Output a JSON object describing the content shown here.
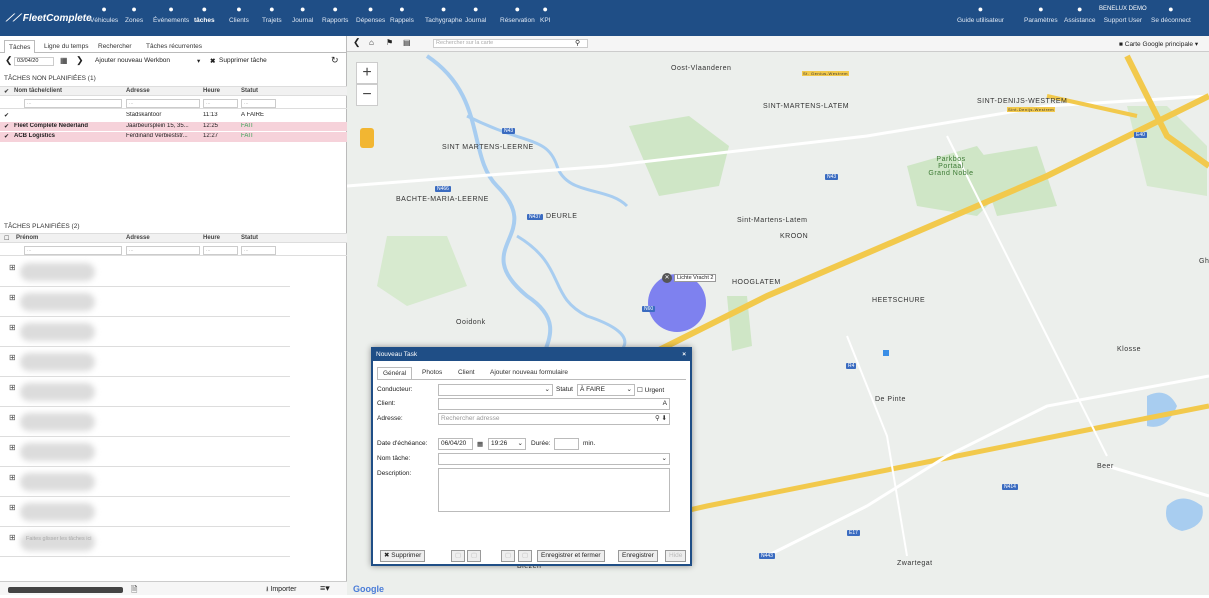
{
  "brand": "FleetComplete",
  "nav": [
    {
      "label": "Véhicules",
      "icon": "car-icon"
    },
    {
      "label": "Zones",
      "icon": "pin-icon"
    },
    {
      "label": "Événements",
      "icon": "warning-icon"
    },
    {
      "label": "tâches",
      "icon": "wrench-icon",
      "active": true
    },
    {
      "label": "Clients",
      "icon": "user-icon"
    },
    {
      "label": "Trajets",
      "icon": "route-icon"
    },
    {
      "label": "Journal",
      "icon": "calendar-icon"
    },
    {
      "label": "Rapports",
      "icon": "report-icon"
    },
    {
      "label": "Dépenses",
      "icon": "euro-icon"
    },
    {
      "label": "Rappels",
      "icon": "reminder-icon"
    },
    {
      "label": "Tachygraphe",
      "icon": "tachograph-icon"
    },
    {
      "label": "Journal",
      "icon": "journal-icon"
    },
    {
      "label": "Réservation",
      "icon": "reservation-icon"
    },
    {
      "label": "KPI",
      "icon": "kpi-icon"
    }
  ],
  "right_nav": [
    {
      "label": "Guide utilisateur",
      "icon": "book-icon"
    },
    {
      "label": "Paramètres",
      "icon": "gears-icon"
    },
    {
      "label": "Assistance",
      "icon": "chat-icon"
    },
    {
      "label": "Support User",
      "top": "BENELUX DEMO"
    },
    {
      "label": "Se déconnect",
      "icon": "logout-icon"
    }
  ],
  "left_tabs": [
    "Tâches",
    "Ligne du temps",
    "Rechercher",
    "Tâches récurrentes"
  ],
  "toolbar": {
    "date": "03/04/20",
    "add": "Ajouter nouveau Werkbon",
    "delete": "Supprimer tâche"
  },
  "unplanned": {
    "title": "TÂCHES NON PLANIFIÉES (1)",
    "headers": [
      "Nom tâche/client",
      "Adresse",
      "Heure",
      "Statut"
    ],
    "filter_placeholder": "...",
    "rows": [
      {
        "name": "",
        "address": "Stadskantoor",
        "time": "11:13",
        "status": "À FAIRE",
        "pink": false
      },
      {
        "name": "Fleet Complete Nederland",
        "address": "Jaarbeursplein 15, 35...",
        "time": "12:25",
        "status": "FAIT",
        "pink": true
      },
      {
        "name": "ACB Logistics",
        "address": "Ferdinand Verbieststr...",
        "time": "12:27",
        "status": "FAIT",
        "pink": true
      }
    ]
  },
  "planned": {
    "title": "TÂCHES PLANIFIÉES (2)",
    "headers": [
      "Prénom",
      "Adresse",
      "Heure",
      "Statut"
    ],
    "drop_hint": "Faites glisser les tâches ici"
  },
  "bottom": {
    "import": "Importer"
  },
  "map": {
    "search_placeholder": "Rechercher sur la carte",
    "map_type": "Carte Google principale",
    "marker_label": "Lichte Vracht 2",
    "places": [
      "Oost-Vlaanderen",
      "SINT-MARTENS-LATEM",
      "SINT-DENIJS-WESTREM",
      "SINT MARTENS-LEERNE",
      "BACHTE-MARIA-LEERNE",
      "DEURLE",
      "Sint-Martens-Latem",
      "KROON",
      "Parkbos Portaal Grand Noble",
      "HOOGLATEM",
      "HEETSCHURE",
      "Ooidonk",
      "Klosse",
      "De Pinte",
      "Beer",
      "Zwartegat",
      "ZEVERGEM",
      "Biezen",
      "St. Genius-Westrem",
      "Sint-Denijs-Westrem",
      "Ghe"
    ],
    "roads": [
      "N43",
      "N466",
      "N437",
      "N43",
      "N60",
      "E40",
      "R4",
      "E17",
      "N414",
      "N443"
    ],
    "google": "Google"
  },
  "dialog": {
    "title": "Nouveau Task",
    "tabs": [
      "Général",
      "Photos",
      "Client",
      "Ajouter nouveau formulaire"
    ],
    "driver_label": "Conducteur:",
    "status_label": "Statut",
    "status_value": "À FAIRE",
    "urgent_label": "Urgent",
    "client_label": "Client:",
    "address_label": "Adresse:",
    "address_placeholder": "Rechercher adresse",
    "due_label": "Date d'échéance:",
    "due_date": "06/04/20",
    "due_time": "19:26",
    "duration_label": "Durée:",
    "duration_unit": "min.",
    "task_name_label": "Nom tâche:",
    "description_label": "Description:",
    "btn_delete": "Supprimer",
    "btn_save_close": "Enregistrer et fermer",
    "btn_save": "Enregistrer",
    "btn_extra": "Hide"
  }
}
